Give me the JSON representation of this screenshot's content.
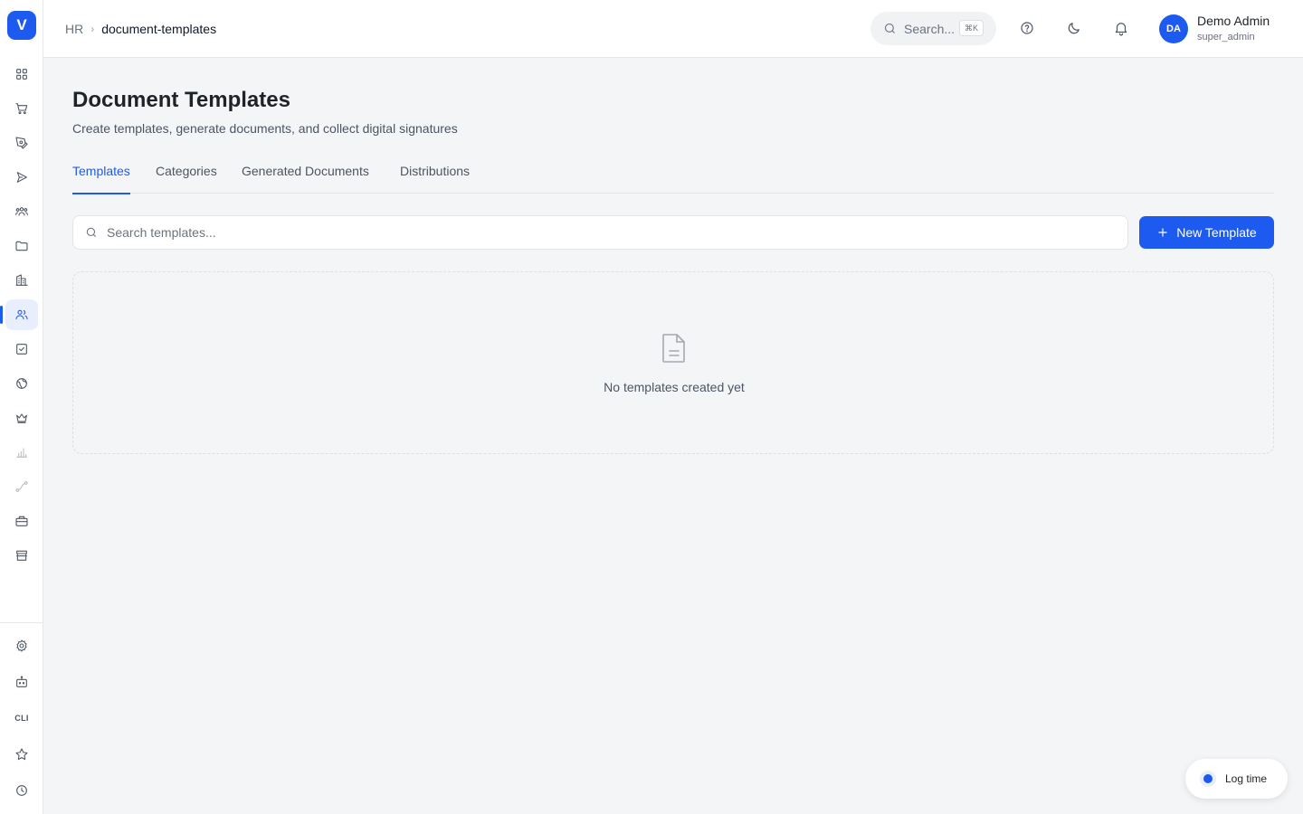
{
  "app": {
    "logo_letter": "V"
  },
  "breadcrumb": {
    "root": "HR",
    "separator": "›",
    "current": "document-templates"
  },
  "header": {
    "search_placeholder": "Search...",
    "search_shortcut": "⌘K",
    "user": {
      "initials": "DA",
      "name": "Demo Admin",
      "role": "super_admin"
    }
  },
  "sidebar": {
    "items": [
      {
        "name": "dashboard-grid-icon"
      },
      {
        "name": "shopping-cart-icon"
      },
      {
        "name": "pen-tool-icon"
      },
      {
        "name": "send-icon"
      },
      {
        "name": "users-group-icon"
      },
      {
        "name": "folder-icon"
      },
      {
        "name": "building-icon"
      },
      {
        "name": "users-icon",
        "active": true
      },
      {
        "name": "checkbox-icon"
      },
      {
        "name": "globe-icon"
      },
      {
        "name": "crown-icon"
      },
      {
        "name": "bar-chart-icon",
        "faded": true
      },
      {
        "name": "route-icon",
        "faded": true
      },
      {
        "name": "briefcase-icon"
      },
      {
        "name": "store-icon"
      }
    ],
    "bottom": {
      "cli_label": "CLI"
    },
    "accent_color": "#1d5bf0"
  },
  "page": {
    "title": "Document Templates",
    "subtitle": "Create templates, generate documents, and collect digital signatures"
  },
  "tabs": [
    {
      "label": "Templates",
      "active": true
    },
    {
      "label": "Categories"
    },
    {
      "label": "Generated Documents"
    },
    {
      "label": "Distributions"
    }
  ],
  "templates": {
    "search_placeholder": "Search templates...",
    "search_value": "",
    "new_button_label": "New Template",
    "empty_message": "No templates created yet"
  },
  "log_time": {
    "label": "Log time"
  }
}
